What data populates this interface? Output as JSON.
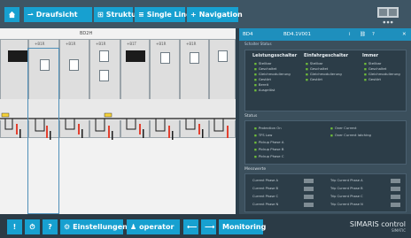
{
  "toolbar": {
    "home_icon": "home-icon",
    "draufsicht": "Draufsicht",
    "struktur": "Struktur",
    "single_line": "Single Line",
    "navigation": "Navigation"
  },
  "canvas": {
    "busbar_label": "BD2H",
    "section_labels": [
      "+B1R",
      "+B1R",
      "+B1R",
      "+B1T",
      "+B1R",
      "+B1R"
    ]
  },
  "panel": {
    "header_left": "BD4",
    "header_mid": "BD4.1V001",
    "header_icons": [
      "i",
      "⛓",
      "?"
    ],
    "close": "✕",
    "section_title": "Schalter Status",
    "col1_title": "Leistungsschalter",
    "col1_items": [
      "Stellbar",
      "Geschaltet",
      "Gleichmodulierung",
      "Gestört",
      "Bereit",
      "Ausgelöst"
    ],
    "col2_title": "Einfahrgeschalter",
    "col2_items": [
      "Stellbar",
      "Geschaltet",
      "Gleichmodulierung",
      "Gestört"
    ],
    "col3_title": "Immer",
    "col3_items": [
      "Stellbar",
      "Geschaltet",
      "Gleichmodulierung",
      "Gestört"
    ],
    "status_title": "Status",
    "status_left": [
      "Protection On",
      "TFS Low",
      "Pickup Phase A",
      "Pickup Phase B",
      "Pickup Phase C"
    ],
    "status_right": [
      "Over Current",
      "Over Current latching"
    ],
    "measure_title": "Messwerte",
    "measure_left": [
      "Current Phase A",
      "Current Phase B",
      "Current Phase C",
      "Current Phase N"
    ],
    "measure_right": [
      "Trip Current Phase A",
      "Trip Current Phase B",
      "Trip Current Phase C",
      "Trip Current Phase N"
    ]
  },
  "bottom": {
    "btn1": "!",
    "btn2": "⏱",
    "btn3": "?",
    "einstellungen": "Einstellungen",
    "operator": "operator",
    "monitoring": "Monitoring",
    "brand": "SIMARIS control",
    "brand_sub": "SIMATIC"
  },
  "colors": {
    "accent": "#17a0d0",
    "status_ok": "#6fbf3a",
    "alarm": "#e3402f"
  }
}
